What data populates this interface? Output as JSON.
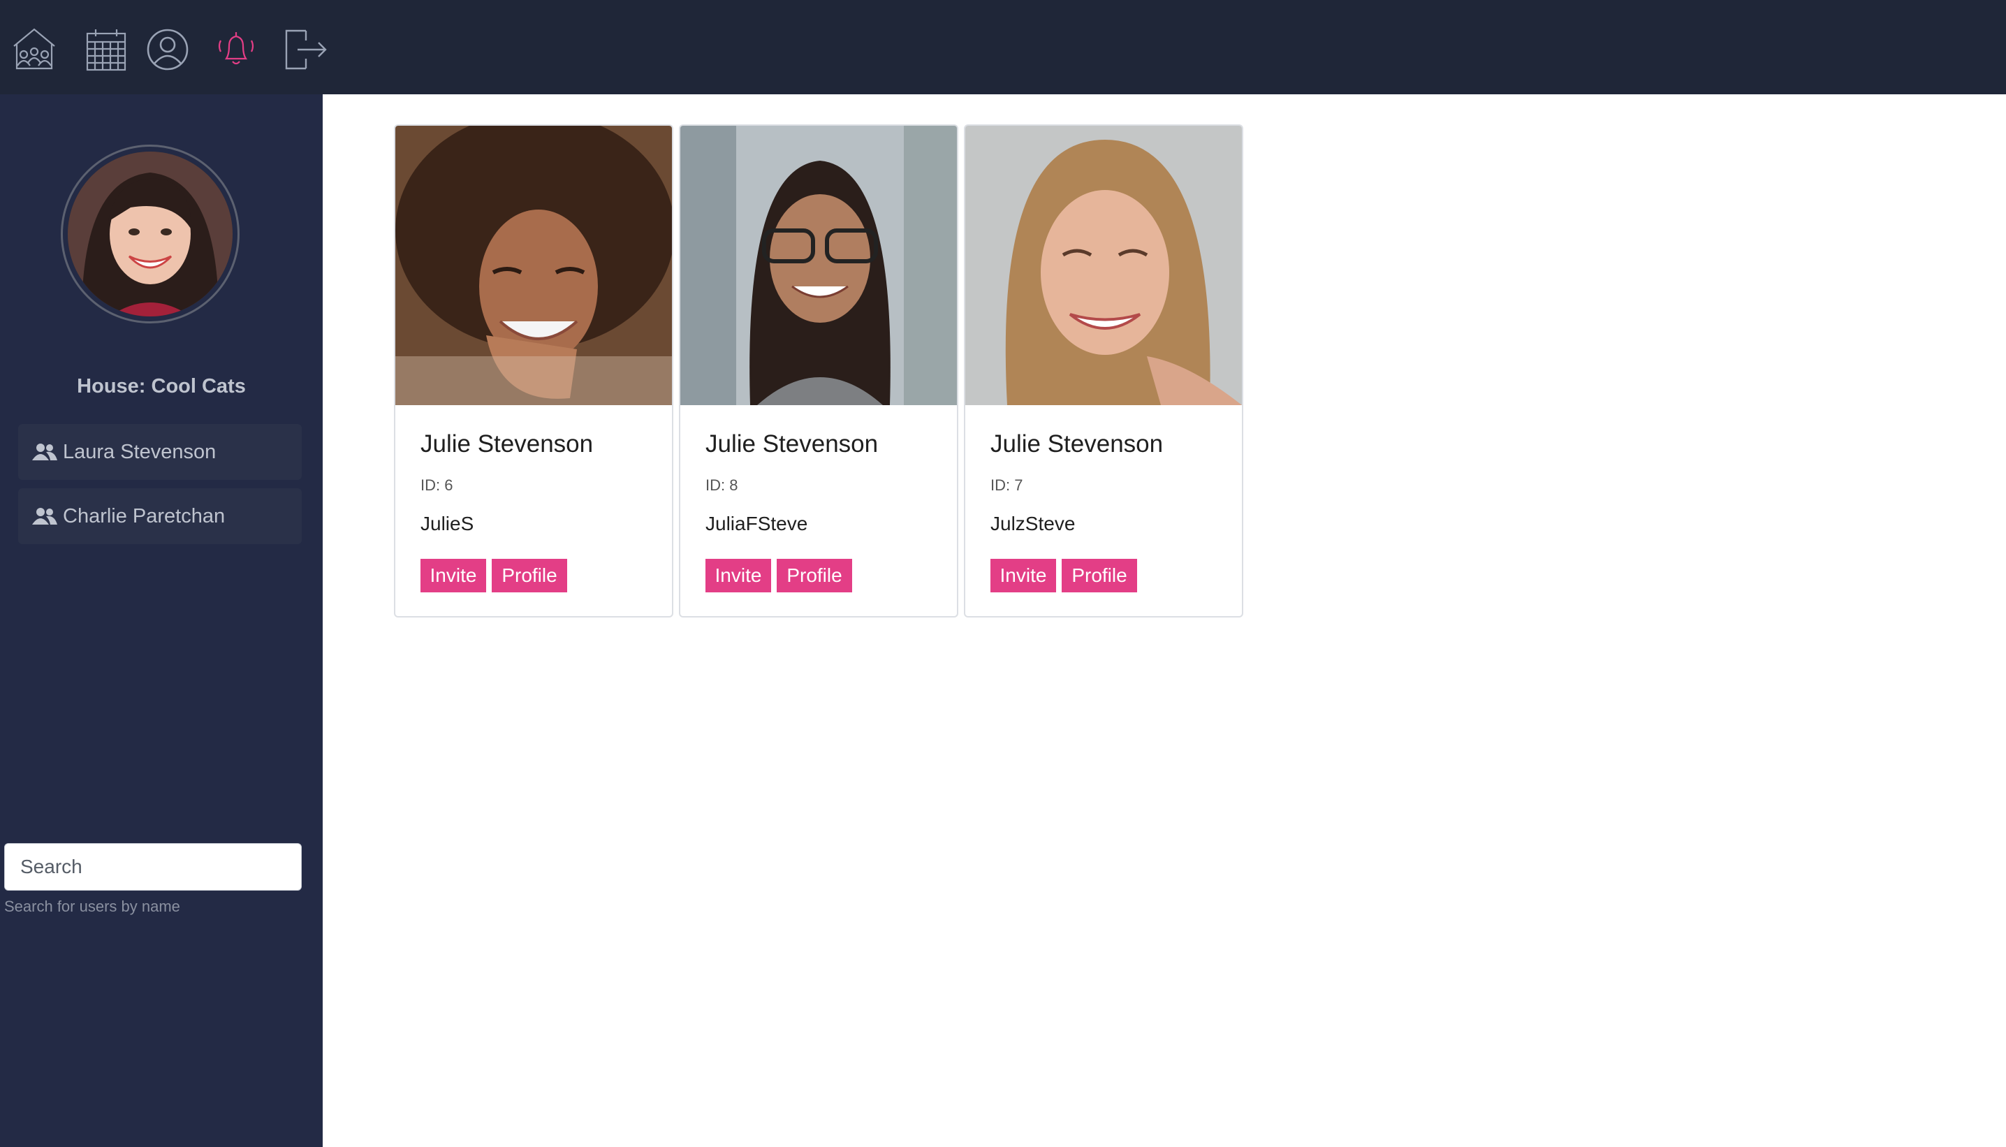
{
  "nav": {
    "icons": [
      "house-community-icon",
      "calendar-icon",
      "user-profile-icon",
      "notification-bell-icon",
      "logout-icon"
    ],
    "colors": {
      "default": "#9aa3b5",
      "active": "#e33e86",
      "background": "#1f2638"
    }
  },
  "sidebar": {
    "house_title": "House: Cool Cats",
    "members": [
      {
        "name": "Laura Stevenson",
        "icon": "users-icon"
      },
      {
        "name": "Charlie Paretchan",
        "icon": "users-icon"
      }
    ],
    "search": {
      "placeholder": "Search",
      "value": "",
      "help": "Search for users by name"
    },
    "background": "#232a45"
  },
  "cards": [
    {
      "name": "Julie Stevenson",
      "id_label": "ID: 6",
      "username": "JulieS",
      "invite_label": "Invite",
      "profile_label": "Profile"
    },
    {
      "name": "Julie Stevenson",
      "id_label": "ID: 8",
      "username": "JuliaFSteve",
      "invite_label": "Invite",
      "profile_label": "Profile"
    },
    {
      "name": "Julie Stevenson",
      "id_label": "ID: 7",
      "username": "JulzSteve",
      "invite_label": "Invite",
      "profile_label": "Profile"
    }
  ],
  "accent_color": "#e33e86"
}
